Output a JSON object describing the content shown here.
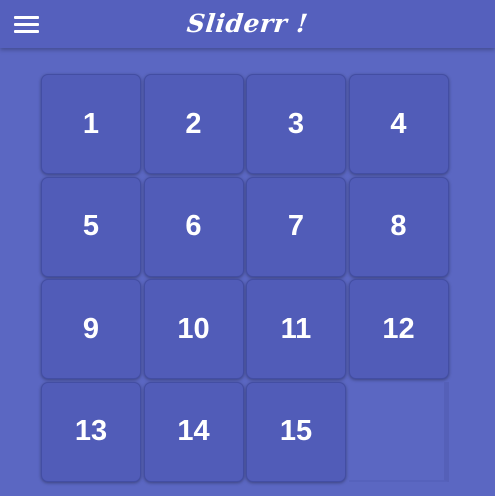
{
  "app_bar": {
    "title": "Sliderr !",
    "menu_icon": "hamburger-menu-icon"
  },
  "colors": {
    "background": "#5b67c2",
    "app_bar": "#5560bd",
    "tile": "#515cb8",
    "tile_border": "#434ea3",
    "text": "#ffffff"
  },
  "board": {
    "size": 4,
    "tiles": [
      "1",
      "2",
      "3",
      "4",
      "5",
      "6",
      "7",
      "8",
      "9",
      "10",
      "11",
      "12",
      "13",
      "14",
      "15",
      ""
    ]
  }
}
